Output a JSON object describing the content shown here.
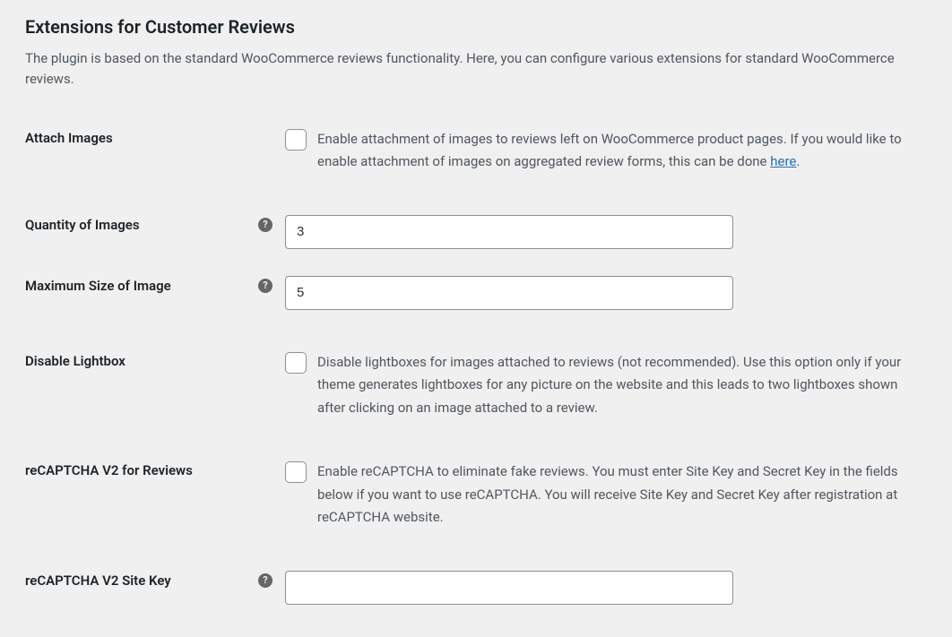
{
  "heading": "Extensions for Customer Reviews",
  "description": "The plugin is based on the standard WooCommerce reviews functionality. Here, you can configure various extensions for standard WooCommerce reviews.",
  "fields": {
    "attach_images": {
      "label": "Attach Images",
      "description_before_link": "Enable attachment of images to reviews left on WooCommerce product pages. If you would like to enable attachment of images on aggregated review forms, this can be done ",
      "link_text": "here",
      "description_after_link": "."
    },
    "quantity": {
      "label": "Quantity of Images",
      "value": "3"
    },
    "max_size": {
      "label": "Maximum Size of Image",
      "value": "5"
    },
    "disable_lightbox": {
      "label": "Disable Lightbox",
      "description": "Disable lightboxes for images attached to reviews (not recommended). Use this option only if your theme generates lightboxes for any picture on the website and this leads to two lightboxes shown after clicking on an image attached to a review."
    },
    "recaptcha": {
      "label": "reCAPTCHA V2 for Reviews",
      "description": "Enable reCAPTCHA to eliminate fake reviews. You must enter Site Key and Secret Key in the fields below if you want to use reCAPTCHA. You will receive Site Key and Secret Key after registration at reCAPTCHA website."
    },
    "site_key": {
      "label": "reCAPTCHA V2 Site Key",
      "value": ""
    }
  },
  "help_icon": "?"
}
